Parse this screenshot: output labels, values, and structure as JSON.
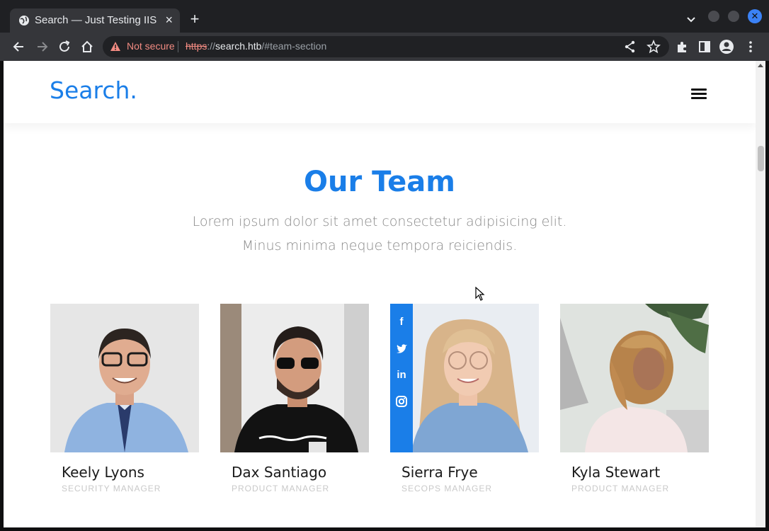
{
  "browser": {
    "tab_title": "Search — Just Testing IIS",
    "tab_close": "×",
    "new_tab": "+",
    "security_label": "Not secure",
    "url_scheme": "https",
    "url_sep": "://",
    "url_host": "search.htb",
    "url_path": "/#team-section",
    "accent_color": "#1a73e8",
    "icons": [
      "globe-icon",
      "back-icon",
      "forward-icon",
      "reload-icon",
      "home-icon",
      "warning-icon",
      "share-icon",
      "star-icon",
      "extensions-icon",
      "sidepanel-icon",
      "profile-icon",
      "menu-icon"
    ]
  },
  "site": {
    "logo": "Search.",
    "brand_color": "#1a7ee8",
    "section_title": "Our Team",
    "section_subtitle": "Lorem ipsum dolor sit amet consectetur adipisicing elit. Minus minima neque tempora reiciendis."
  },
  "team": [
    {
      "name": "Keely Lyons",
      "role": "SECURITY MANAGER"
    },
    {
      "name": "Dax Santiago",
      "role": "PRODUCT MANAGER"
    },
    {
      "name": "Sierra Frye",
      "role": "SECOPS MANAGER",
      "social": [
        "f",
        "twitter",
        "in",
        "instagram"
      ]
    },
    {
      "name": "Kyla Stewart",
      "role": "PRODUCT MANAGER"
    }
  ],
  "social_labels": {
    "facebook": "f",
    "linkedin": "in"
  }
}
